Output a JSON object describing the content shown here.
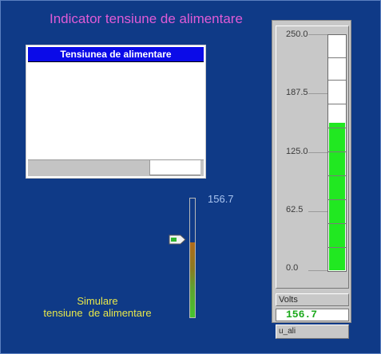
{
  "title": "Indicator tensiune de alimentare",
  "trend": {
    "header": "Tensiunea de alimentare"
  },
  "slider": {
    "value_text": "156.7",
    "level_fraction": 0.627,
    "label_line1": "Simulare",
    "label_line2": "tensiune  de alimentare"
  },
  "gauge": {
    "scale_labels": [
      "250.0",
      "187.5",
      "125.0",
      "62.5",
      "0.0"
    ],
    "min": 0,
    "max": 250,
    "value": 156.7,
    "units": "Volts",
    "readout": "156.7",
    "tag": "u_ali",
    "fill_color": "#21e821"
  },
  "colors": {
    "background": "#0f3a87",
    "title": "#e05bd6",
    "trend_header": "#0b0be8",
    "sim_label": "#e8e84a"
  }
}
